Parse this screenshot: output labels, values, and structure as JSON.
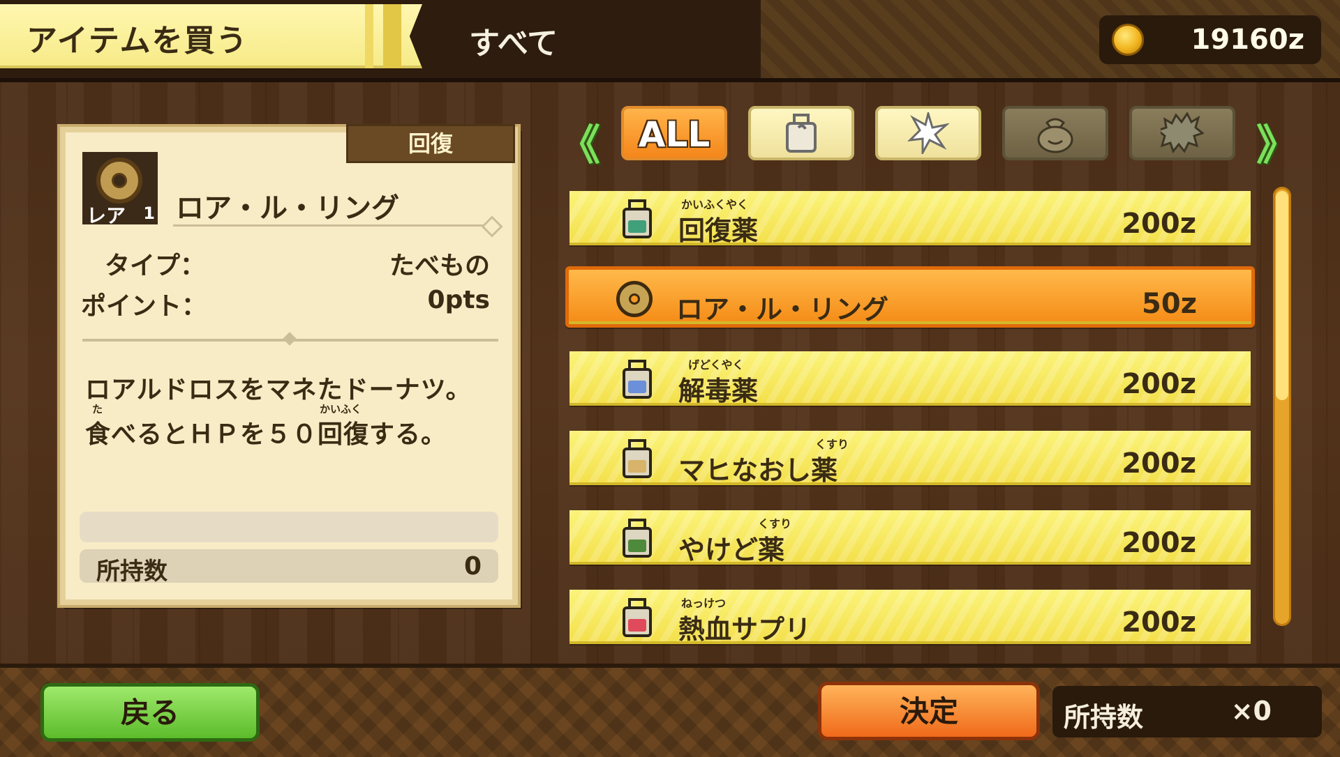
{
  "header": {
    "title": "アイテムを買う",
    "category": "すべて",
    "money": "19160z"
  },
  "detail": {
    "category_tag": "回復",
    "rarity_label": "レア",
    "rarity_value": "1",
    "item_name": "ロア・ル・リング",
    "type_label": "タイプ：",
    "type_value": "たべもの",
    "points_label": "ポイント：",
    "points_value": "0pts",
    "description_line1": "ロアルドロスをマネたドーナツ。",
    "description_line2": "食べるとＨＰを５０回復する。",
    "ruby_taberu": "た",
    "ruby_kaifuku": "かいふく",
    "owned_label": "所持数",
    "owned_value": "0"
  },
  "tabs": {
    "prev": "《",
    "next": "》",
    "all_label": "ALL",
    "items": [
      {
        "name": "all",
        "state": "active"
      },
      {
        "name": "potion",
        "state": "normal"
      },
      {
        "name": "sparkle",
        "state": "normal"
      },
      {
        "name": "bag",
        "state": "dim"
      },
      {
        "name": "monster",
        "state": "dim"
      }
    ]
  },
  "shop_items": [
    {
      "name": "回復薬",
      "ruby": "かいふくやく",
      "price": "200z",
      "icon": "potion-green-icon",
      "color": "#3fa07a"
    },
    {
      "name": "ロア・ル・リング",
      "ruby": "",
      "price": "50z",
      "icon": "ring-icon",
      "color": "#c7a453",
      "selected": true
    },
    {
      "name": "解毒薬",
      "ruby": "げどくやく",
      "price": "200z",
      "icon": "potion-blue-icon",
      "color": "#6b8fd8"
    },
    {
      "name": "マヒなおし薬",
      "ruby": "くすり",
      "price": "200z",
      "icon": "potion-tan-icon",
      "color": "#d8b36a"
    },
    {
      "name": "やけど薬",
      "ruby": "くすり",
      "price": "200z",
      "icon": "potion-darkgreen-icon",
      "color": "#4f8a3c"
    },
    {
      "name": "熱血サプリ",
      "ruby": "ねっけつ",
      "price": "200z",
      "icon": "potion-red-icon",
      "color": "#e04a5a"
    }
  ],
  "footer": {
    "back_label": "戻る",
    "ok_label": "決定",
    "owned_label": "所持数",
    "owned_value": "×0"
  },
  "colors": {
    "list_yellow": "#f3df4a",
    "selected_orange": "#f58b16",
    "wood": "#4a2e18"
  }
}
